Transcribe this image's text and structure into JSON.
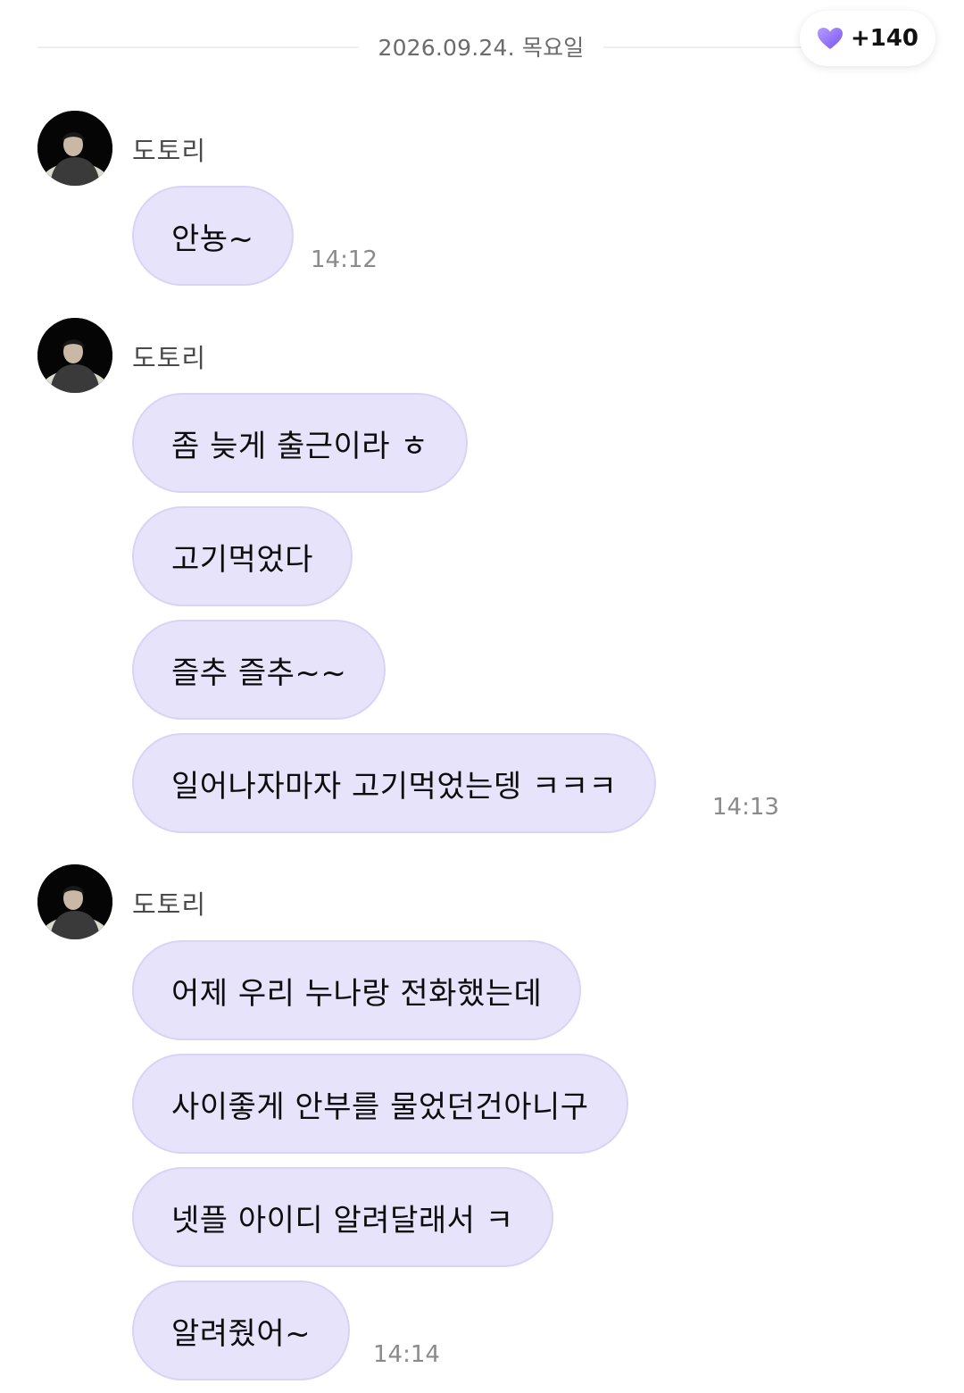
{
  "date_divider": {
    "label": "2026.09.24. 목요일"
  },
  "heart_badge": {
    "icon": "heart-icon",
    "count": "+140",
    "color": "#8f6cf7"
  },
  "colors": {
    "bubble_bg": "#e6e3fb",
    "bubble_border": "#d8d4f5"
  },
  "groups": [
    {
      "sender": "도토리",
      "messages": [
        {
          "text": "안뇽~",
          "time": "14:12"
        }
      ]
    },
    {
      "sender": "도토리",
      "messages": [
        {
          "text": "좀 늦게 출근이라 ㅎ",
          "time": ""
        },
        {
          "text": "고기먹었다",
          "time": ""
        },
        {
          "text": "즐추 즐추~~",
          "time": ""
        },
        {
          "text": "일어나자마자 고기먹었는뎅 ㅋㅋㅋ",
          "time": "14:13"
        }
      ]
    },
    {
      "sender": "도토리",
      "messages": [
        {
          "text": "어제 우리 누나랑 전화했는데",
          "time": ""
        },
        {
          "text": "사이좋게 안부를 물었던건아니구",
          "time": ""
        },
        {
          "text": "넷플 아이디 알려달래서 ㅋ",
          "time": ""
        },
        {
          "text": "알려줬어~",
          "time": "14:14"
        }
      ]
    }
  ]
}
